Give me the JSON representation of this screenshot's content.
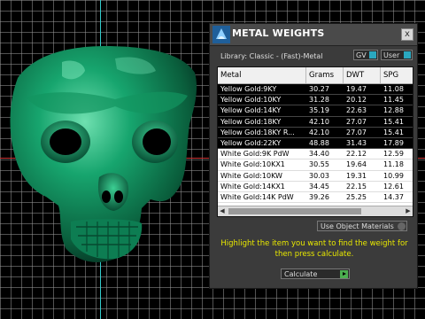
{
  "panel": {
    "title": "METAL WEIGHTS",
    "close_label": "x",
    "library_label": "Library: Classic - (Fast)-Metal",
    "toggles": [
      {
        "label": "GV"
      },
      {
        "label": "User"
      }
    ],
    "table": {
      "columns": [
        "Metal",
        "Grams",
        "DWT",
        "SPG"
      ],
      "rows": [
        {
          "metal": "Yellow Gold:9KY",
          "grams": "30.27",
          "dwt": "19.47",
          "spg": "11.08",
          "selected": true
        },
        {
          "metal": "Yellow Gold:10KY",
          "grams": "31.28",
          "dwt": "20.12",
          "spg": "11.45",
          "selected": true
        },
        {
          "metal": "Yellow Gold:14KY",
          "grams": "35.19",
          "dwt": "22.63",
          "spg": "12.88",
          "selected": true
        },
        {
          "metal": "Yellow Gold:18KY",
          "grams": "42.10",
          "dwt": "27.07",
          "spg": "15.41",
          "selected": true
        },
        {
          "metal": "Yellow Gold:18KY R...",
          "grams": "42.10",
          "dwt": "27.07",
          "spg": "15.41",
          "selected": true
        },
        {
          "metal": "Yellow Gold:22KY",
          "grams": "48.88",
          "dwt": "31.43",
          "spg": "17.89",
          "selected": true
        },
        {
          "metal": "White Gold:9K PdW",
          "grams": "34.40",
          "dwt": "22.12",
          "spg": "12.59",
          "selected": false
        },
        {
          "metal": "White Gold:10KX1",
          "grams": "30.55",
          "dwt": "19.64",
          "spg": "11.18",
          "selected": false
        },
        {
          "metal": "White Gold:10KW",
          "grams": "30.03",
          "dwt": "19.31",
          "spg": "10.99",
          "selected": false
        },
        {
          "metal": "White Gold:14KX1",
          "grams": "34.45",
          "dwt": "22.15",
          "spg": "12.61",
          "selected": false
        },
        {
          "metal": "White Gold:14K PdW",
          "grams": "39.26",
          "dwt": "25.25",
          "spg": "14.37",
          "selected": false
        }
      ]
    },
    "materials_dropdown": "Use Object Materials",
    "instructions": "Highlight the item you want to find the weight for then press calculate.",
    "calculate_label": "Calculate"
  },
  "colors": {
    "skull": "#0e8a5a",
    "instructions": "#e8e800",
    "accent": "#2aa8c0"
  },
  "icons": {
    "logo": "rhino-logo-icon",
    "close": "close-icon",
    "calculate": "play-icon"
  }
}
